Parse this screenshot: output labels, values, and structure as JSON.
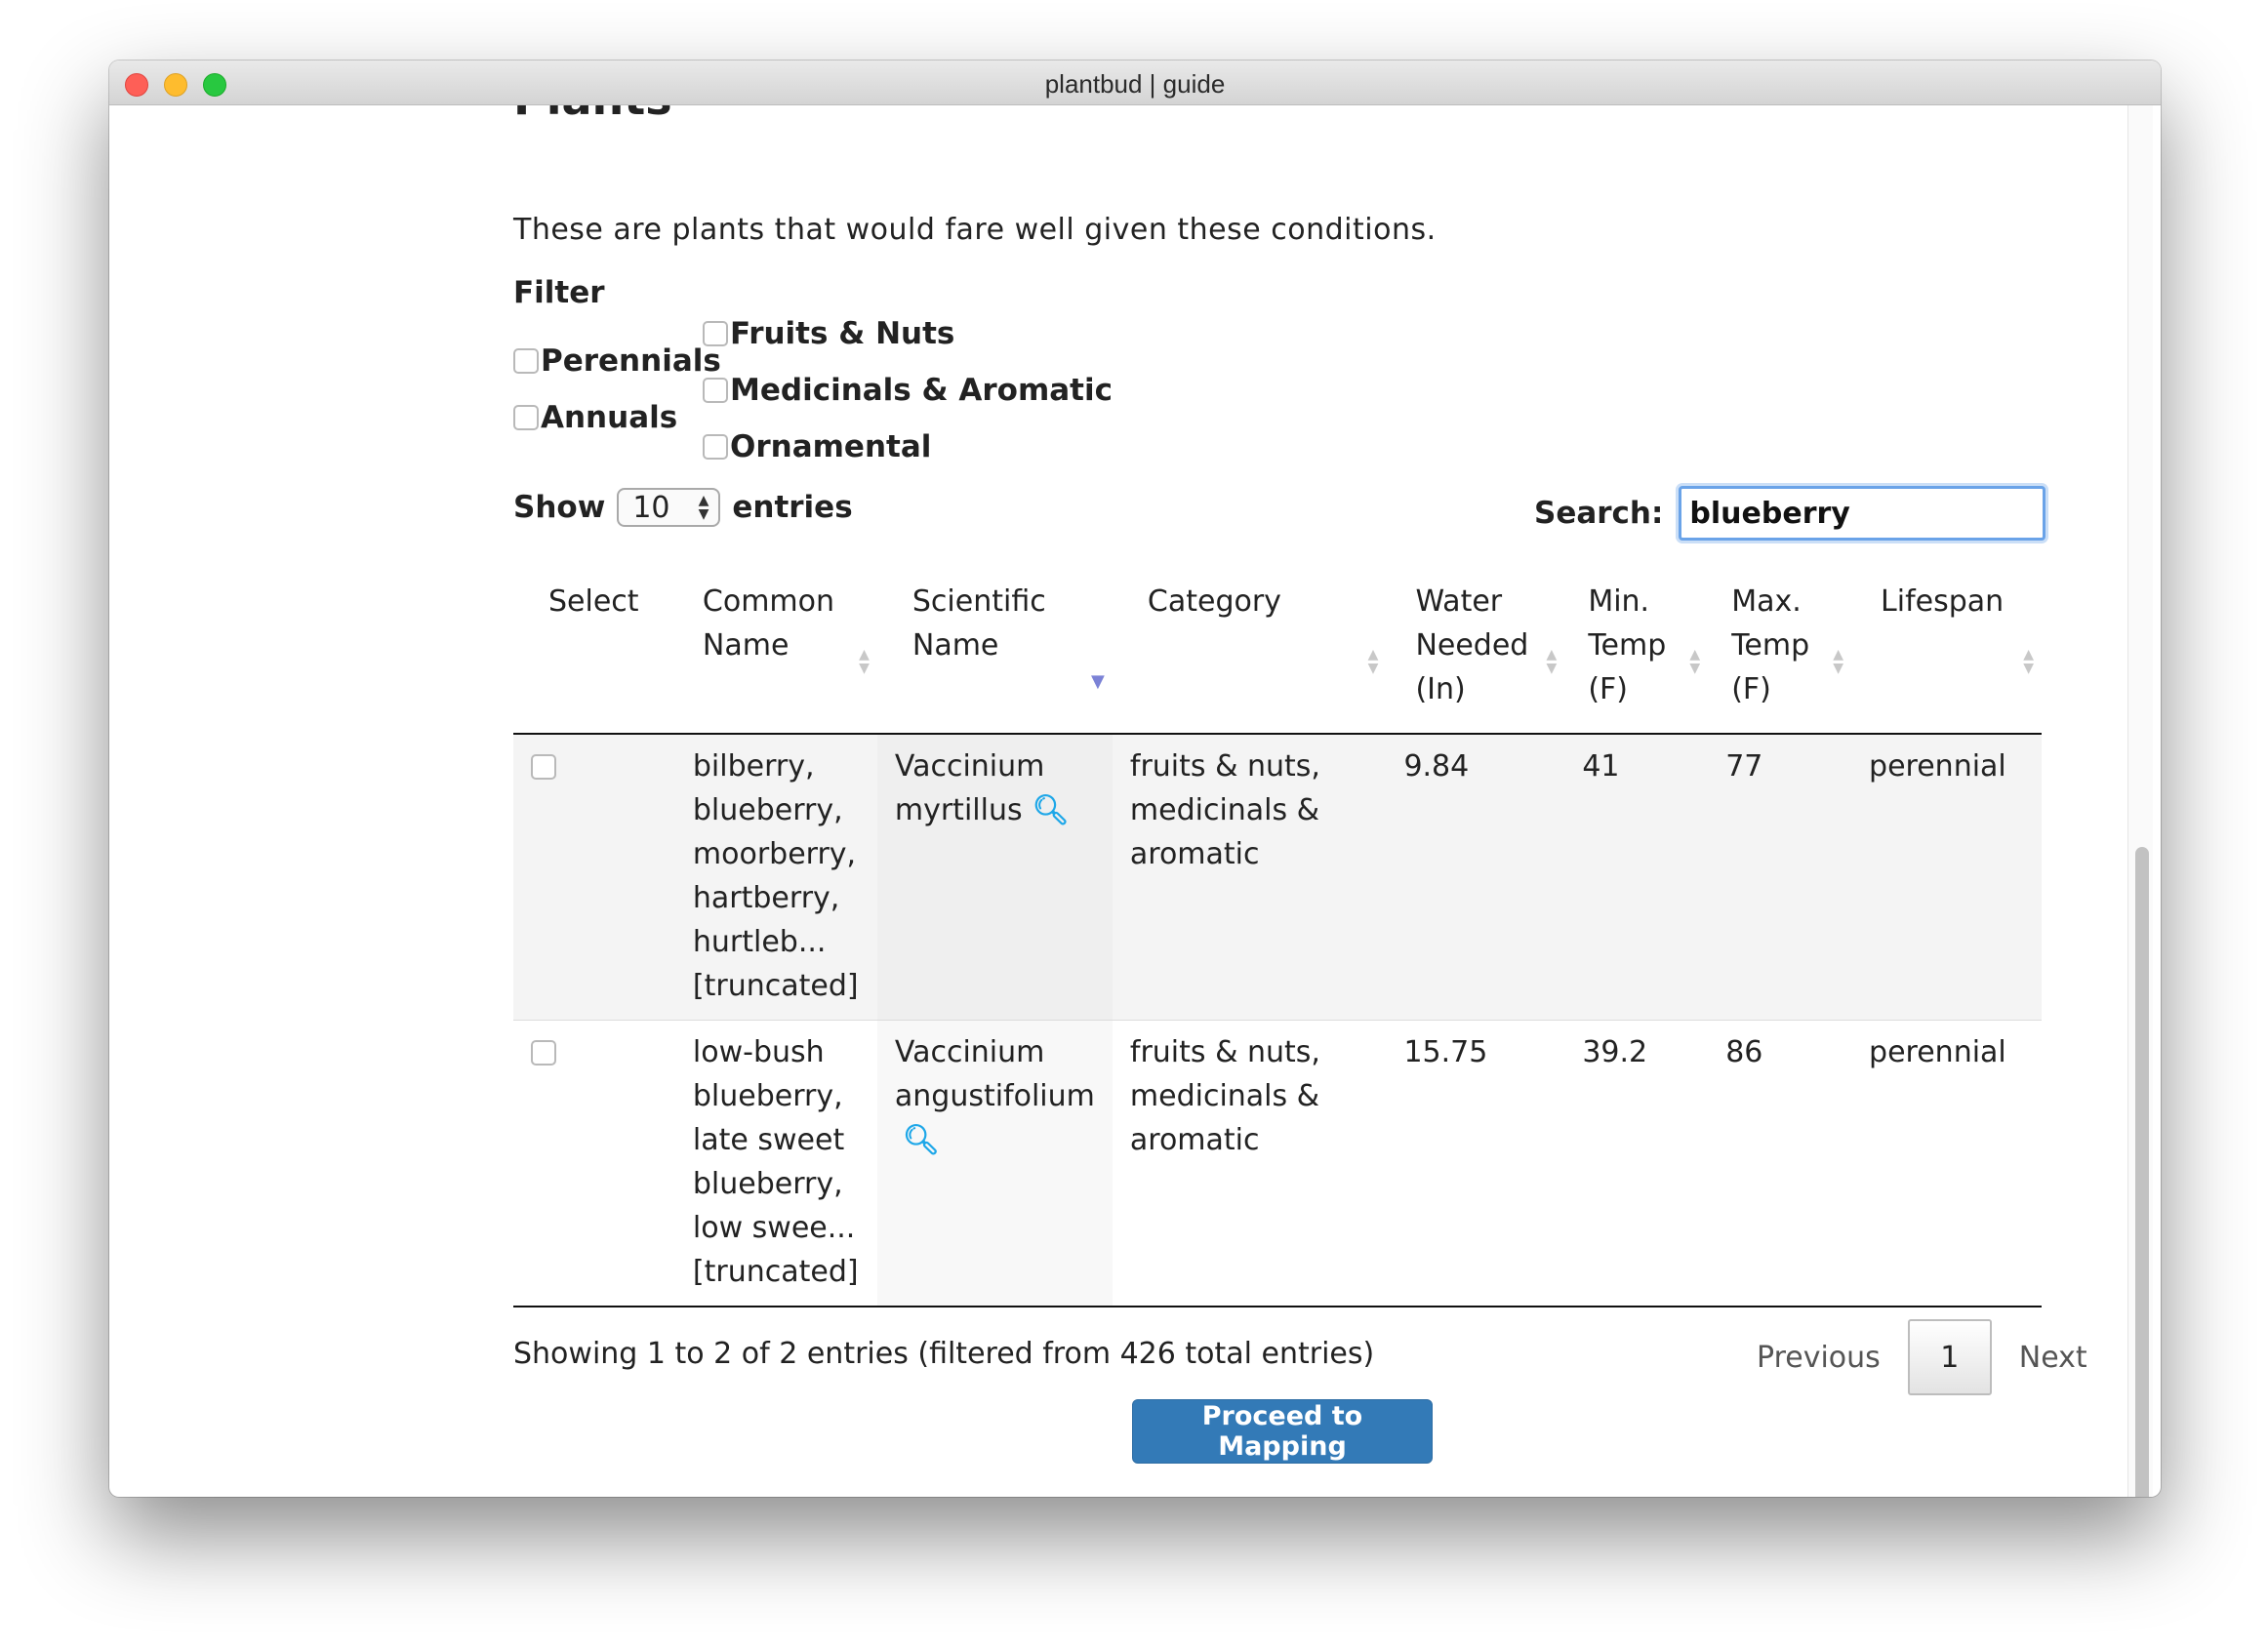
{
  "window": {
    "title": "plantbud | guide"
  },
  "page": {
    "heading": "Plants",
    "intro": "These are plants that would fare well given these conditions.",
    "filter_label": "Filter",
    "filters_left": [
      "Perennials",
      "Annuals"
    ],
    "filters_right": [
      "Fruits & Nuts",
      "Medicinals & Aromatic",
      "Ornamental"
    ]
  },
  "table_controls": {
    "show_label": "Show",
    "length_value": "10",
    "entries_label": "entries",
    "search_label": "Search:",
    "search_value": "blueberry"
  },
  "table": {
    "columns": [
      [
        "Select"
      ],
      [
        "Common",
        "Name"
      ],
      [
        "Scientific",
        "Name"
      ],
      [
        "Category"
      ],
      [
        "Water",
        "Needed",
        "(In)"
      ],
      [
        "Min.",
        "Temp",
        "(F)"
      ],
      [
        "Max.",
        "Temp",
        "(F)"
      ],
      [
        "Lifespan"
      ]
    ],
    "rows": [
      {
        "common": [
          "bilberry,",
          "blueberry,",
          "moorberry,",
          "hartberry,",
          "hurtleb...",
          "[truncated]"
        ],
        "scientific": [
          "Vaccinium",
          "myrtillus"
        ],
        "category": [
          "fruits & nuts,",
          "medicinals &",
          "aromatic"
        ],
        "water": "9.84",
        "min_temp": "41",
        "max_temp": "77",
        "lifespan": "perennial"
      },
      {
        "common": [
          "low-bush",
          "blueberry,",
          "late sweet",
          "blueberry,",
          "low swee...",
          "[truncated]"
        ],
        "scientific": [
          "Vaccinium",
          "angustifolium"
        ],
        "category": [
          "fruits & nuts,",
          "medicinals &",
          "aromatic"
        ],
        "water": "15.75",
        "min_temp": "39.2",
        "max_temp": "86",
        "lifespan": "perennial"
      }
    ]
  },
  "footer": {
    "info": "Showing 1 to 2 of 2 entries (filtered from 426 total entries)",
    "previous": "Previous",
    "page": "1",
    "next": "Next",
    "proceed": "Proceed to Mapping"
  },
  "colors": {
    "primary_button": "#337ab7",
    "search_focus": "#6aa3e8",
    "magnifier": "#1ea7e8"
  }
}
